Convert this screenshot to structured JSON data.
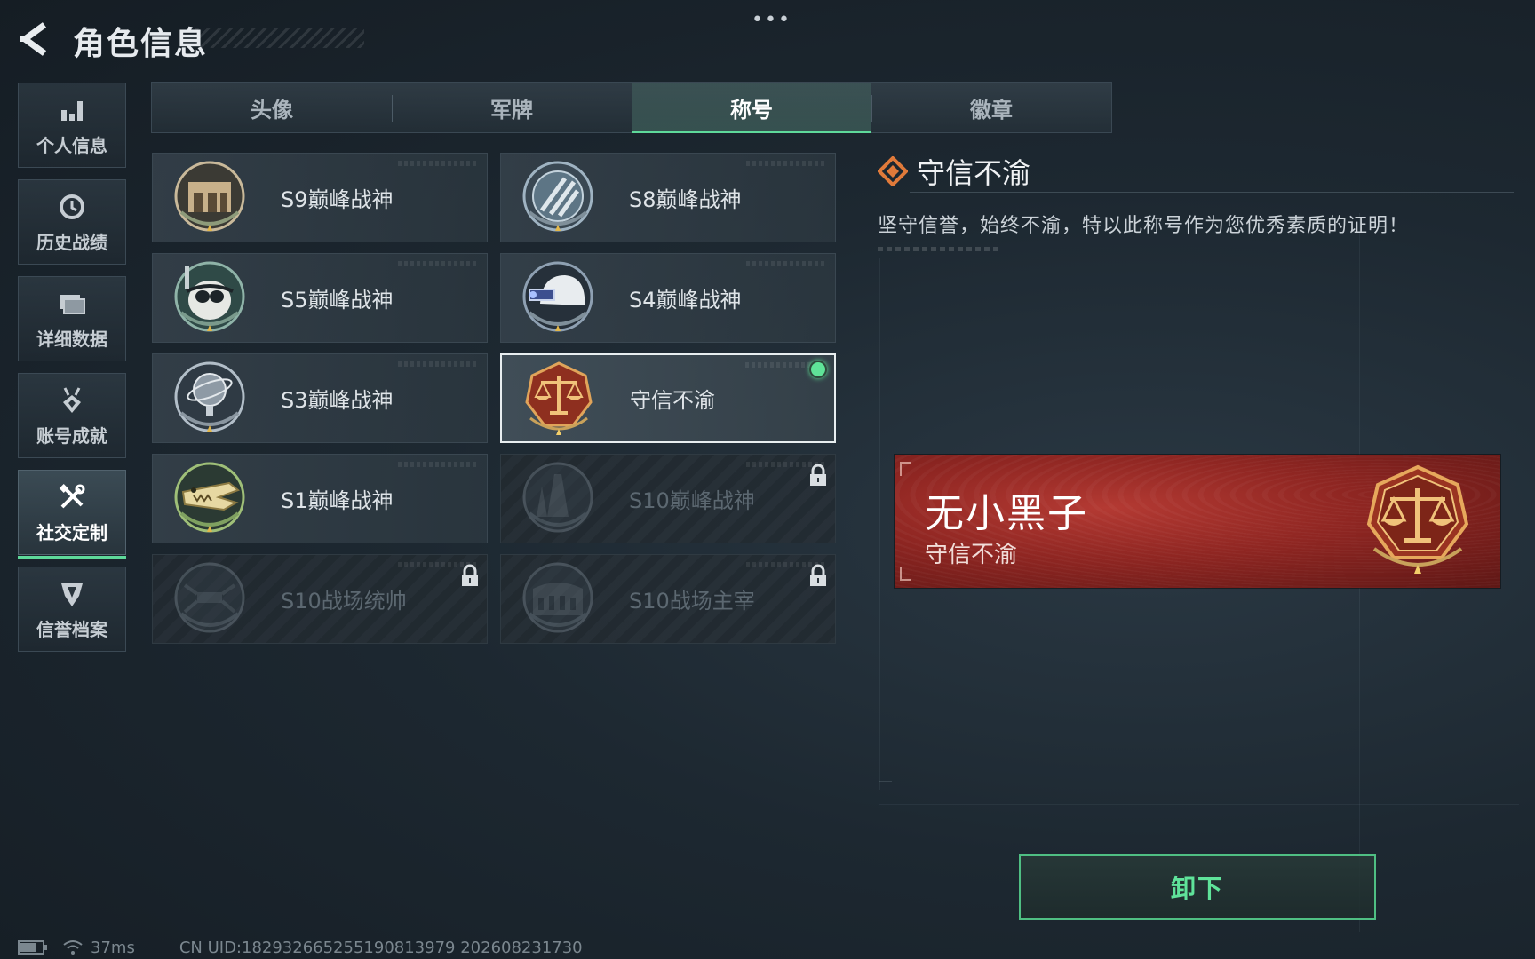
{
  "header": {
    "title": "角色信息",
    "more_icon": "ellipsis-icon"
  },
  "sidebar": {
    "items": [
      {
        "label": "个人信息",
        "icon": "bar-chart-icon",
        "active": false
      },
      {
        "label": "历史战绩",
        "icon": "clock-icon",
        "active": false
      },
      {
        "label": "详细数据",
        "icon": "folder-icon",
        "active": false
      },
      {
        "label": "账号成就",
        "icon": "medal-icon",
        "active": false
      },
      {
        "label": "社交定制",
        "icon": "tools-icon",
        "active": true
      },
      {
        "label": "信誉档案",
        "icon": "shield-icon",
        "active": false
      }
    ]
  },
  "tabs": [
    {
      "label": "头像",
      "active": false
    },
    {
      "label": "军牌",
      "active": false
    },
    {
      "label": "称号",
      "active": true
    },
    {
      "label": "徽章",
      "active": false
    }
  ],
  "titles": [
    {
      "label": "S9巅峰战神",
      "icon": "fortress-emblem-icon",
      "state": "unlocked"
    },
    {
      "label": "S8巅峰战神",
      "icon": "striped-emblem-icon",
      "state": "unlocked"
    },
    {
      "label": "S5巅峰战神",
      "icon": "diver-skull-emblem-icon",
      "state": "unlocked"
    },
    {
      "label": "S4巅峰战神",
      "icon": "night-vision-helmet-emblem-icon",
      "state": "unlocked"
    },
    {
      "label": "S3巅峰战神",
      "icon": "globe-emblem-icon",
      "state": "unlocked"
    },
    {
      "label": "守信不渝",
      "icon": "scales-emblem-icon",
      "state": "equipped"
    },
    {
      "label": "S1巅峰战神",
      "icon": "crocodile-emblem-icon",
      "state": "unlocked"
    },
    {
      "label": "S10巅峰战神",
      "icon": "tower-emblem-icon",
      "state": "locked"
    },
    {
      "label": "S10战场统帅",
      "icon": "drone-emblem-icon",
      "state": "locked"
    },
    {
      "label": "S10战场主宰",
      "icon": "colosseum-emblem-icon",
      "state": "locked"
    }
  ],
  "detail": {
    "title": "守信不渝",
    "description": "坚守信誉，始终不渝，特以此称号作为您优秀素质的证明！"
  },
  "nameplate": {
    "player_name": "无小黑子",
    "title": "守信不渝",
    "emblem_icon": "scales-emblem-icon"
  },
  "action": {
    "unequip_label": "卸下"
  },
  "footer": {
    "ping": "37ms",
    "uid_text": "CN UID:1829326652551908139​79 202608231730"
  },
  "colors": {
    "accent_green": "#5ed99a",
    "nameplate_red": "#a02d28",
    "emblem_orange": "#e07a3a"
  }
}
